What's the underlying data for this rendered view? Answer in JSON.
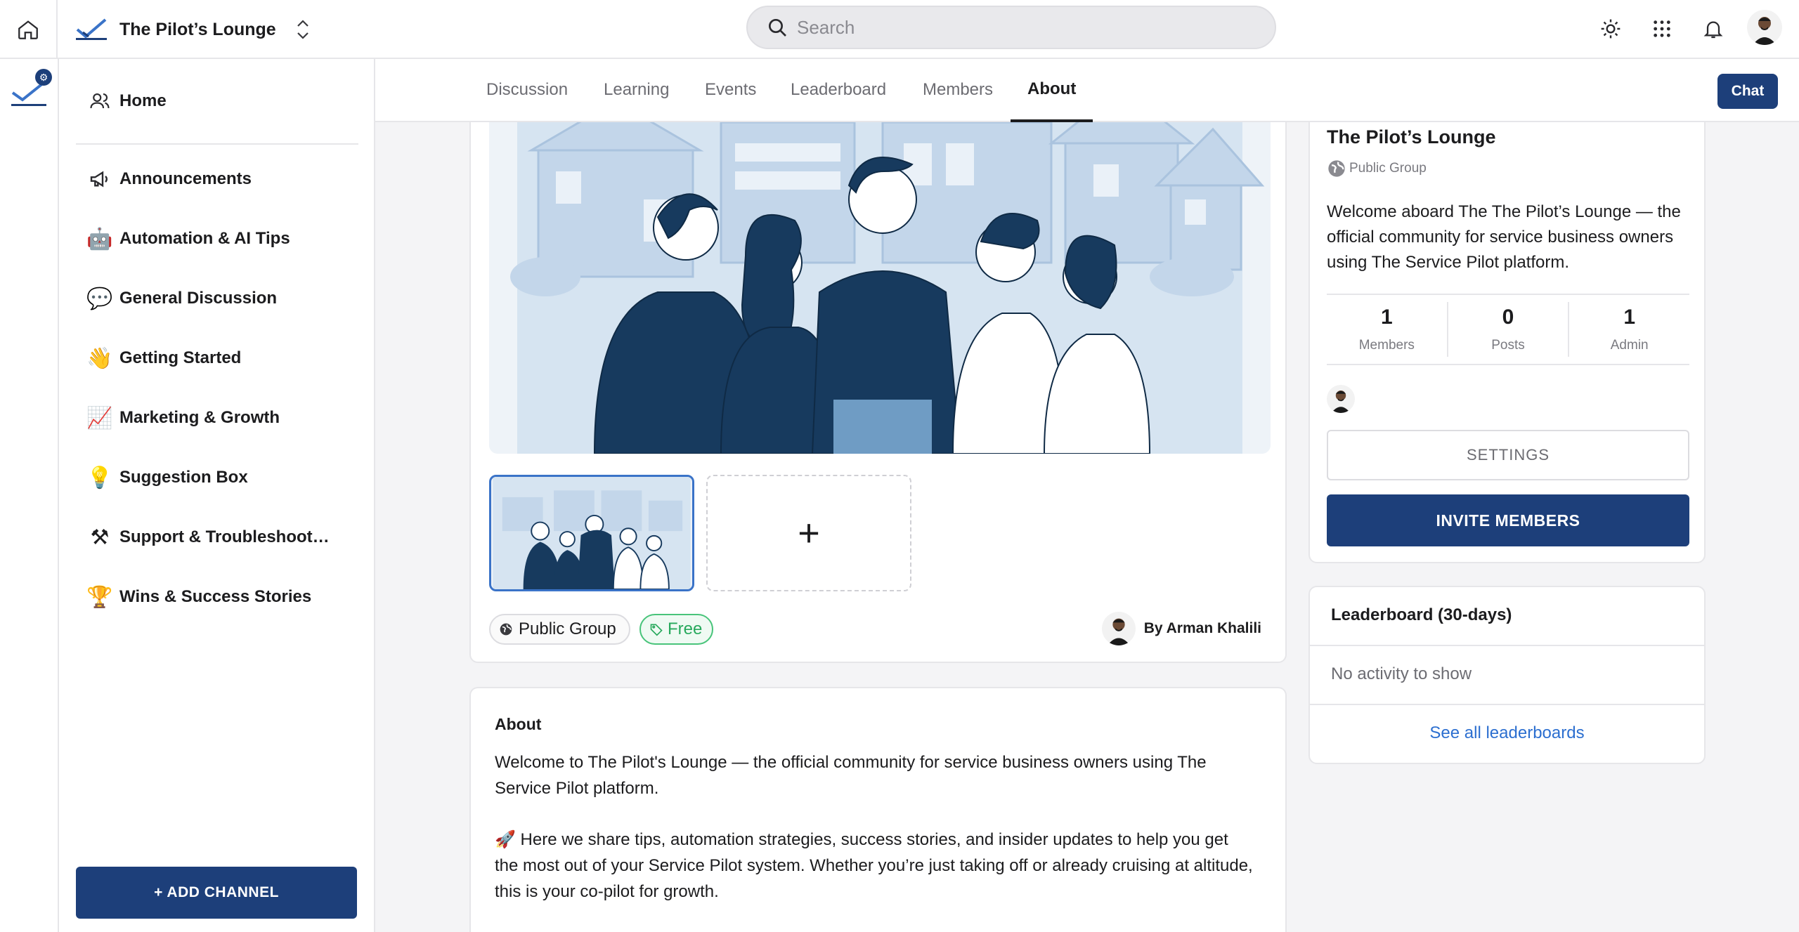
{
  "topbar": {
    "community_name": "The Pilot’s Lounge",
    "search_placeholder": "Search"
  },
  "sidebar": {
    "home_label": "Home",
    "channels": [
      {
        "label": "Announcements",
        "icon": "megaphone-icon"
      },
      {
        "label": "Automation & AI Tips",
        "icon": "robot-icon"
      },
      {
        "label": "General Discussion",
        "icon": "speech-bubble-icon"
      },
      {
        "label": "Getting Started",
        "icon": "waving-hand-icon"
      },
      {
        "label": "Marketing & Growth",
        "icon": "chart-up-icon"
      },
      {
        "label": "Suggestion Box",
        "icon": "light-bulb-icon"
      },
      {
        "label": "Support & Troubleshoot…",
        "icon": "hammer-pick-icon"
      },
      {
        "label": "Wins & Success Stories",
        "icon": "trophy-icon"
      }
    ],
    "add_channel_label": "+ ADD CHANNEL"
  },
  "tabs": {
    "items": [
      "Discussion",
      "Learning",
      "Events",
      "Leaderboard",
      "Members",
      "About"
    ],
    "active": "About",
    "chat_label": "Chat"
  },
  "group": {
    "public_chip": "Public Group",
    "price_chip": "Free",
    "author": "By Arman Khalili"
  },
  "about": {
    "heading": "About",
    "paragraph1": "Welcome to The Pilot's Lounge — the official community for service business owners using The Service Pilot platform.",
    "paragraph2": "🚀 Here we share tips, automation strategies, success stories, and insider updates to help you get the most out of your Service Pilot system. Whether you’re just taking off or already cruising at altitude, this is your co-pilot for growth."
  },
  "info": {
    "title": "The Pilot’s Lounge",
    "visibility": "Public Group",
    "description": "Welcome aboard The The Pilot’s Lounge — the official community for service business owners using The Service Pilot platform.",
    "stats": [
      {
        "value": "1",
        "label": "Members"
      },
      {
        "value": "0",
        "label": "Posts"
      },
      {
        "value": "1",
        "label": "Admin"
      }
    ],
    "settings_label": "SETTINGS",
    "invite_label": "INVITE MEMBERS"
  },
  "leaderboard": {
    "title": "Leaderboard (30-days)",
    "empty_text": "No activity to show",
    "link_label": "See all leaderboards"
  },
  "colors": {
    "primary": "#1d3f7a",
    "link": "#2c6fd0",
    "free_green": "#27a95c"
  }
}
